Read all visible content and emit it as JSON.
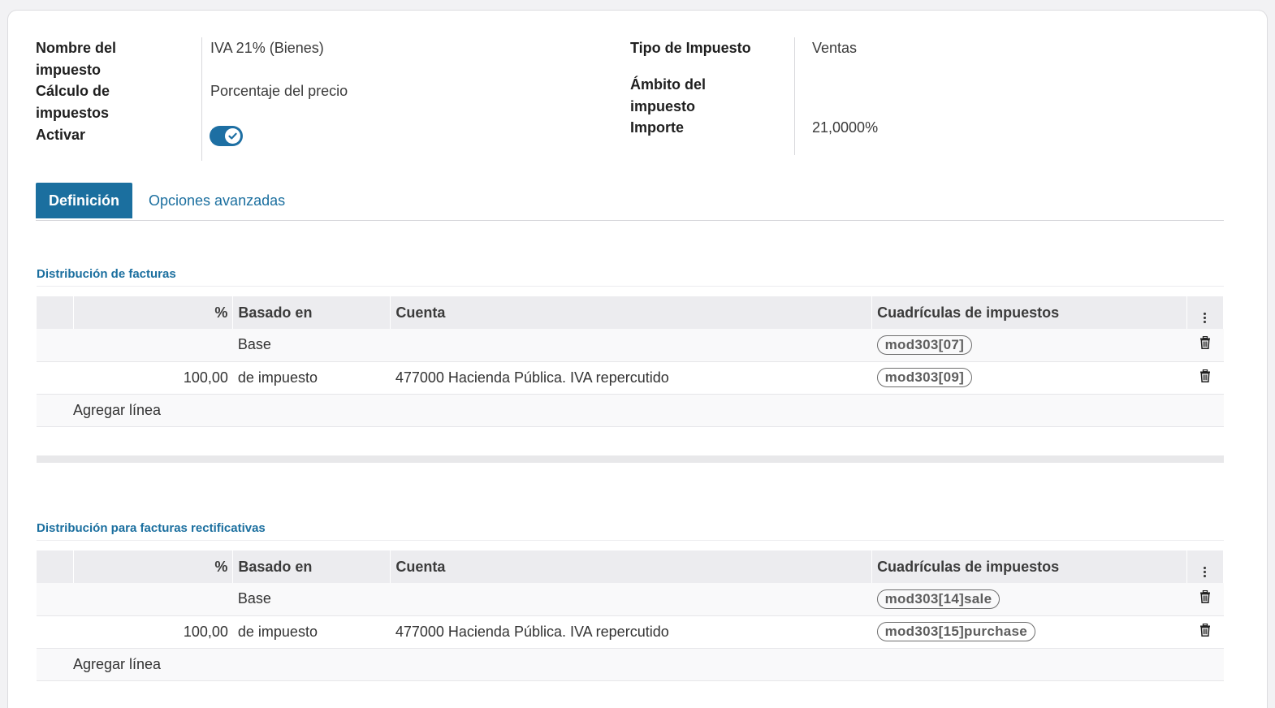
{
  "header": {
    "left": [
      {
        "label": "Nombre del impuesto",
        "value": "IVA 21% (Bienes)"
      },
      {
        "label": "Cálculo de impuestos",
        "value": "Porcentaje del precio"
      },
      {
        "label": "Activar",
        "value": ""
      }
    ],
    "right": [
      {
        "label": "Tipo de Impuesto",
        "value": "Ventas"
      },
      {
        "label": "Ámbito del impuesto",
        "value": ""
      },
      {
        "label": "Importe",
        "value": "21,0000%"
      }
    ],
    "active_toggle": true
  },
  "tabs": [
    {
      "label": "Definición",
      "active": true
    },
    {
      "label": "Opciones avanzadas",
      "active": false
    }
  ],
  "columns": {
    "pct": "%",
    "based_on": "Basado en",
    "account": "Cuenta",
    "tax_grids": "Cuadrículas de impuestos"
  },
  "invoice_section": {
    "title": "Distribución de facturas",
    "rows": [
      {
        "pct": "",
        "based_on": "Base",
        "account": "",
        "tag": "mod303[07]"
      },
      {
        "pct": "100,00",
        "based_on": "de impuesto",
        "account": "477000 Hacienda Pública. IVA repercutido",
        "tag": "mod303[09]"
      }
    ],
    "add_line": "Agregar línea"
  },
  "refund_section": {
    "title": "Distribución para facturas rectificativas",
    "rows": [
      {
        "pct": "",
        "based_on": "Base",
        "account": "",
        "tag": "mod303[14]sale"
      },
      {
        "pct": "100,00",
        "based_on": "de impuesto",
        "account": "477000 Hacienda Pública. IVA repercutido",
        "tag": "mod303[15]purchase"
      }
    ],
    "add_line": "Agregar línea"
  },
  "colors": {
    "accent": "#1b6f9f",
    "header_bg": "#ececef"
  },
  "icons": [
    "check-icon",
    "trash-icon",
    "kebab-menu-icon"
  ]
}
